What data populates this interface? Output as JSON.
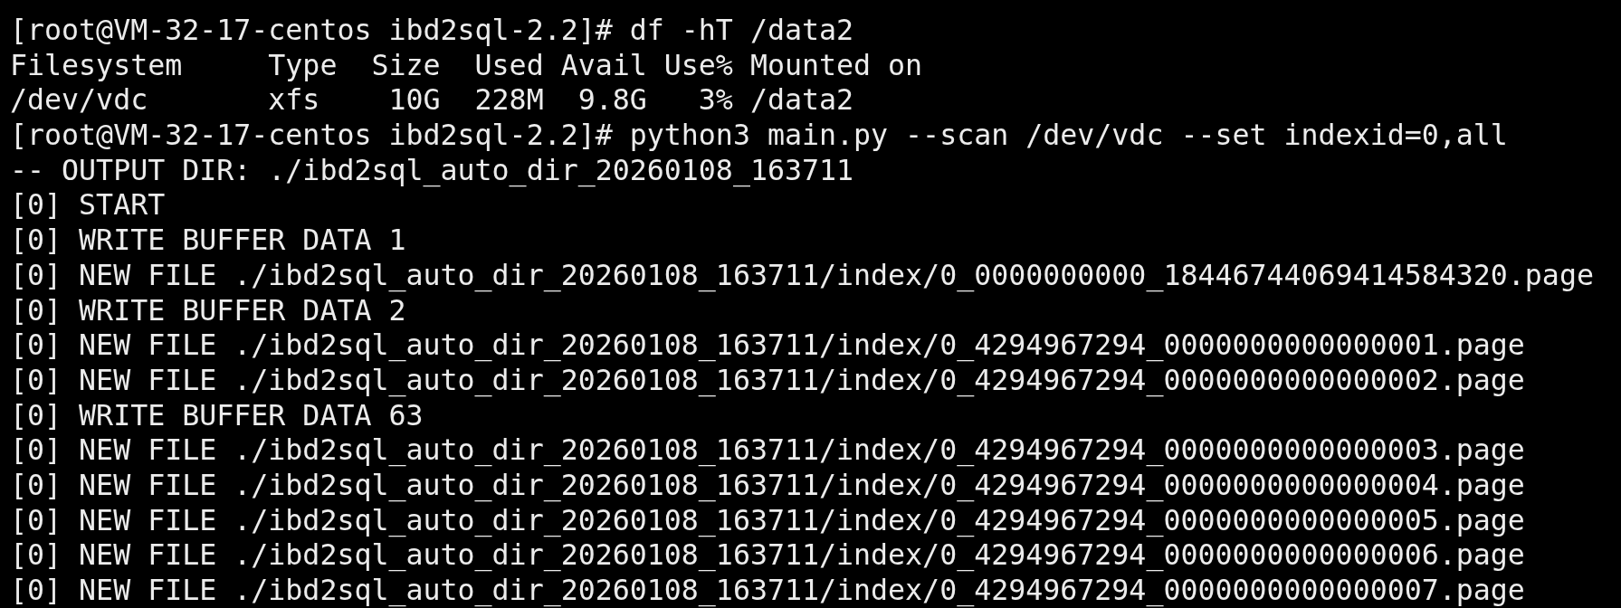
{
  "terminal": {
    "lines": [
      "[root@VM-32-17-centos ibd2sql-2.2]# df -hT /data2",
      "Filesystem     Type  Size  Used Avail Use% Mounted on",
      "/dev/vdc       xfs    10G  228M  9.8G   3% /data2",
      "[root@VM-32-17-centos ibd2sql-2.2]# python3 main.py --scan /dev/vdc --set indexid=0,all",
      "-- OUTPUT DIR: ./ibd2sql_auto_dir_20260108_163711",
      "[0] START",
      "[0] WRITE BUFFER DATA 1",
      "[0] NEW FILE ./ibd2sql_auto_dir_20260108_163711/index/0_0000000000_18446744069414584320.page",
      "[0] WRITE BUFFER DATA 2",
      "[0] NEW FILE ./ibd2sql_auto_dir_20260108_163711/index/0_4294967294_0000000000000001.page",
      "[0] NEW FILE ./ibd2sql_auto_dir_20260108_163711/index/0_4294967294_0000000000000002.page",
      "[0] WRITE BUFFER DATA 63",
      "[0] NEW FILE ./ibd2sql_auto_dir_20260108_163711/index/0_4294967294_0000000000000003.page",
      "[0] NEW FILE ./ibd2sql_auto_dir_20260108_163711/index/0_4294967294_0000000000000004.page",
      "[0] NEW FILE ./ibd2sql_auto_dir_20260108_163711/index/0_4294967294_0000000000000005.page",
      "[0] NEW FILE ./ibd2sql_auto_dir_20260108_163711/index/0_4294967294_0000000000000006.page",
      "[0] NEW FILE ./ibd2sql_auto_dir_20260108_163711/index/0_4294967294_0000000000000007.page"
    ]
  }
}
